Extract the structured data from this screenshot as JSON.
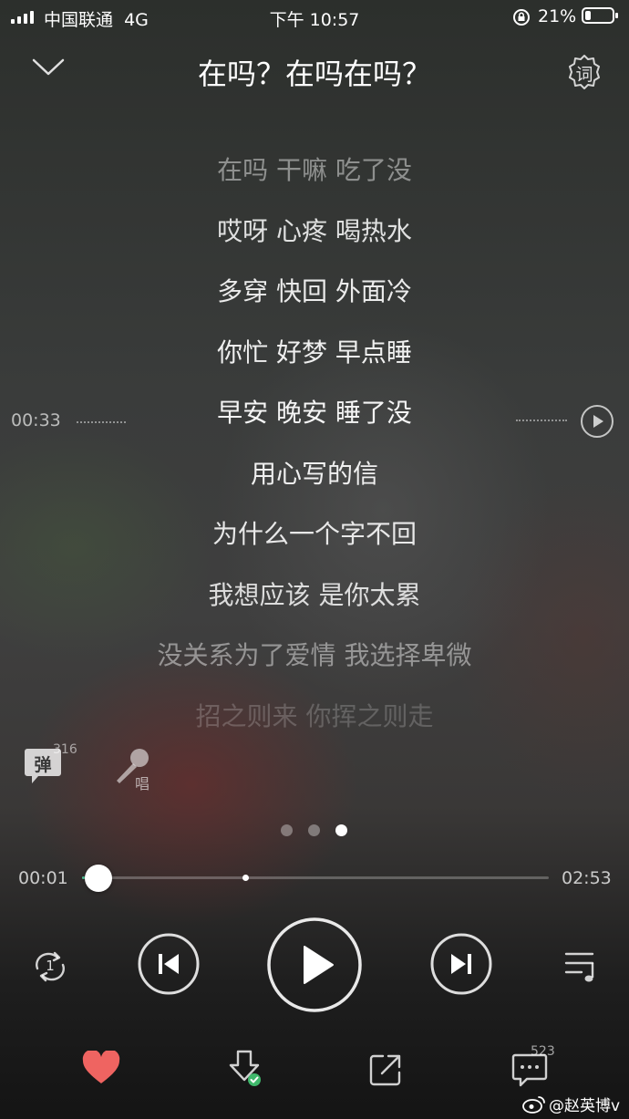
{
  "status_bar": {
    "carrier": "中国联通",
    "network": "4G",
    "time": "下午 10:57",
    "battery_percent": "21%",
    "battery_level": 0.21
  },
  "header": {
    "title": "在吗？在吗在吗？",
    "lyric_button_label": "词"
  },
  "lyrics": {
    "lines": [
      {
        "text": "在吗 干嘛 吃了没",
        "opacity": 0.45
      },
      {
        "text": "哎呀 心疼 喝热水",
        "opacity": 0.85
      },
      {
        "text": "多穿 快回 外面冷",
        "opacity": 0.9
      },
      {
        "text": "你忙 好梦 早点睡",
        "opacity": 0.92
      },
      {
        "text": "早安 晚安 睡了没",
        "opacity": 0.95
      },
      {
        "text": "用心写的信",
        "opacity": 0.92
      },
      {
        "text": "为什么一个字不回",
        "opacity": 0.88
      },
      {
        "text": "我想应该 是你太累",
        "opacity": 0.82
      },
      {
        "text": "没关系为了爱情 我选择卑微",
        "opacity": 0.45
      },
      {
        "text": "招之则来 你挥之则走",
        "opacity": 0.2
      }
    ],
    "scrub_time": "00:33"
  },
  "extras": {
    "danmu_label": "弹",
    "danmu_count": "316",
    "karaoke_label": "唱"
  },
  "pager": {
    "count": 3,
    "active_index": 2
  },
  "playback": {
    "current_time": "00:01",
    "total_time": "02:53",
    "progress": 0.006,
    "buffered": 0.35,
    "repeat_label": "1"
  },
  "bottom": {
    "comment_count": "523",
    "watermark": "@赵英博v"
  },
  "colors": {
    "accent": "#4fc99a",
    "like": "#ef6461",
    "download_badge": "#3fb86b"
  },
  "icons": [
    "chevron-down-icon",
    "lyric-gear-icon",
    "play-circle-icon",
    "danmu-bubble-icon",
    "microphone-icon",
    "repeat-one-icon",
    "previous-icon",
    "play-icon",
    "next-icon",
    "playlist-icon",
    "heart-icon",
    "download-icon",
    "share-icon",
    "comment-icon",
    "weibo-icon"
  ]
}
